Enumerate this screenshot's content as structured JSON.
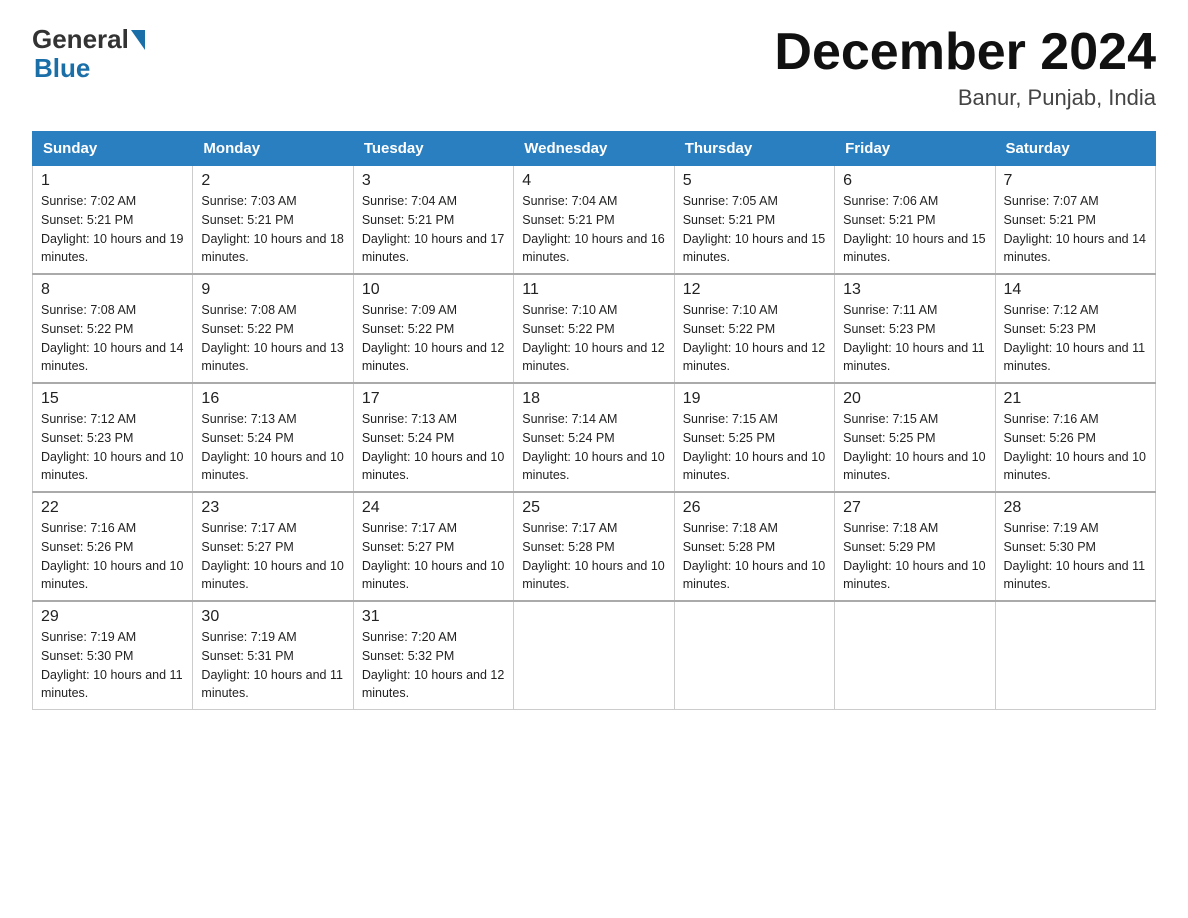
{
  "header": {
    "logo_general": "General",
    "logo_blue": "Blue",
    "title": "December 2024",
    "subtitle": "Banur, Punjab, India"
  },
  "days_of_week": [
    "Sunday",
    "Monday",
    "Tuesday",
    "Wednesday",
    "Thursday",
    "Friday",
    "Saturday"
  ],
  "weeks": [
    [
      {
        "day": "1",
        "sunrise": "7:02 AM",
        "sunset": "5:21 PM",
        "daylight": "10 hours and 19 minutes."
      },
      {
        "day": "2",
        "sunrise": "7:03 AM",
        "sunset": "5:21 PM",
        "daylight": "10 hours and 18 minutes."
      },
      {
        "day": "3",
        "sunrise": "7:04 AM",
        "sunset": "5:21 PM",
        "daylight": "10 hours and 17 minutes."
      },
      {
        "day": "4",
        "sunrise": "7:04 AM",
        "sunset": "5:21 PM",
        "daylight": "10 hours and 16 minutes."
      },
      {
        "day": "5",
        "sunrise": "7:05 AM",
        "sunset": "5:21 PM",
        "daylight": "10 hours and 15 minutes."
      },
      {
        "day": "6",
        "sunrise": "7:06 AM",
        "sunset": "5:21 PM",
        "daylight": "10 hours and 15 minutes."
      },
      {
        "day": "7",
        "sunrise": "7:07 AM",
        "sunset": "5:21 PM",
        "daylight": "10 hours and 14 minutes."
      }
    ],
    [
      {
        "day": "8",
        "sunrise": "7:08 AM",
        "sunset": "5:22 PM",
        "daylight": "10 hours and 14 minutes."
      },
      {
        "day": "9",
        "sunrise": "7:08 AM",
        "sunset": "5:22 PM",
        "daylight": "10 hours and 13 minutes."
      },
      {
        "day": "10",
        "sunrise": "7:09 AM",
        "sunset": "5:22 PM",
        "daylight": "10 hours and 12 minutes."
      },
      {
        "day": "11",
        "sunrise": "7:10 AM",
        "sunset": "5:22 PM",
        "daylight": "10 hours and 12 minutes."
      },
      {
        "day": "12",
        "sunrise": "7:10 AM",
        "sunset": "5:22 PM",
        "daylight": "10 hours and 12 minutes."
      },
      {
        "day": "13",
        "sunrise": "7:11 AM",
        "sunset": "5:23 PM",
        "daylight": "10 hours and 11 minutes."
      },
      {
        "day": "14",
        "sunrise": "7:12 AM",
        "sunset": "5:23 PM",
        "daylight": "10 hours and 11 minutes."
      }
    ],
    [
      {
        "day": "15",
        "sunrise": "7:12 AM",
        "sunset": "5:23 PM",
        "daylight": "10 hours and 10 minutes."
      },
      {
        "day": "16",
        "sunrise": "7:13 AM",
        "sunset": "5:24 PM",
        "daylight": "10 hours and 10 minutes."
      },
      {
        "day": "17",
        "sunrise": "7:13 AM",
        "sunset": "5:24 PM",
        "daylight": "10 hours and 10 minutes."
      },
      {
        "day": "18",
        "sunrise": "7:14 AM",
        "sunset": "5:24 PM",
        "daylight": "10 hours and 10 minutes."
      },
      {
        "day": "19",
        "sunrise": "7:15 AM",
        "sunset": "5:25 PM",
        "daylight": "10 hours and 10 minutes."
      },
      {
        "day": "20",
        "sunrise": "7:15 AM",
        "sunset": "5:25 PM",
        "daylight": "10 hours and 10 minutes."
      },
      {
        "day": "21",
        "sunrise": "7:16 AM",
        "sunset": "5:26 PM",
        "daylight": "10 hours and 10 minutes."
      }
    ],
    [
      {
        "day": "22",
        "sunrise": "7:16 AM",
        "sunset": "5:26 PM",
        "daylight": "10 hours and 10 minutes."
      },
      {
        "day": "23",
        "sunrise": "7:17 AM",
        "sunset": "5:27 PM",
        "daylight": "10 hours and 10 minutes."
      },
      {
        "day": "24",
        "sunrise": "7:17 AM",
        "sunset": "5:27 PM",
        "daylight": "10 hours and 10 minutes."
      },
      {
        "day": "25",
        "sunrise": "7:17 AM",
        "sunset": "5:28 PM",
        "daylight": "10 hours and 10 minutes."
      },
      {
        "day": "26",
        "sunrise": "7:18 AM",
        "sunset": "5:28 PM",
        "daylight": "10 hours and 10 minutes."
      },
      {
        "day": "27",
        "sunrise": "7:18 AM",
        "sunset": "5:29 PM",
        "daylight": "10 hours and 10 minutes."
      },
      {
        "day": "28",
        "sunrise": "7:19 AM",
        "sunset": "5:30 PM",
        "daylight": "10 hours and 11 minutes."
      }
    ],
    [
      {
        "day": "29",
        "sunrise": "7:19 AM",
        "sunset": "5:30 PM",
        "daylight": "10 hours and 11 minutes."
      },
      {
        "day": "30",
        "sunrise": "7:19 AM",
        "sunset": "5:31 PM",
        "daylight": "10 hours and 11 minutes."
      },
      {
        "day": "31",
        "sunrise": "7:20 AM",
        "sunset": "5:32 PM",
        "daylight": "10 hours and 12 minutes."
      },
      null,
      null,
      null,
      null
    ]
  ]
}
